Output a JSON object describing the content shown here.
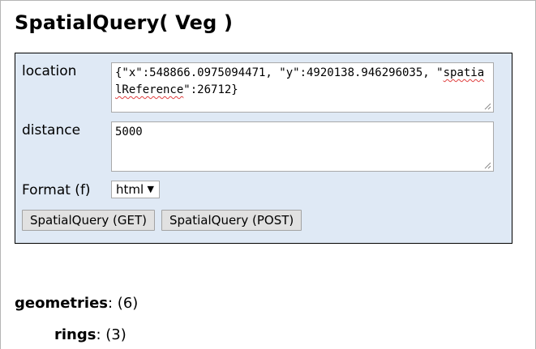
{
  "page": {
    "title": "SpatialQuery( Veg )"
  },
  "form": {
    "location": {
      "label": "location",
      "value_part1": "{\"x\":548866.0975094471, \"y\":4920138.946296035, \"",
      "value_squiggle": "spatialReference",
      "value_part2": "\":26712}"
    },
    "distance": {
      "label": "distance",
      "value": "5000"
    },
    "format": {
      "label": "Format (f)",
      "selected": "html",
      "caret": "▼"
    },
    "buttons": {
      "get": "SpatialQuery (GET)",
      "post": "SpatialQuery (POST)"
    }
  },
  "results": {
    "geometries": {
      "label": "geometries",
      "sep": ": ",
      "count": "(6)"
    },
    "rings": {
      "label": "rings",
      "sep": ": ",
      "count": "(3)"
    }
  }
}
